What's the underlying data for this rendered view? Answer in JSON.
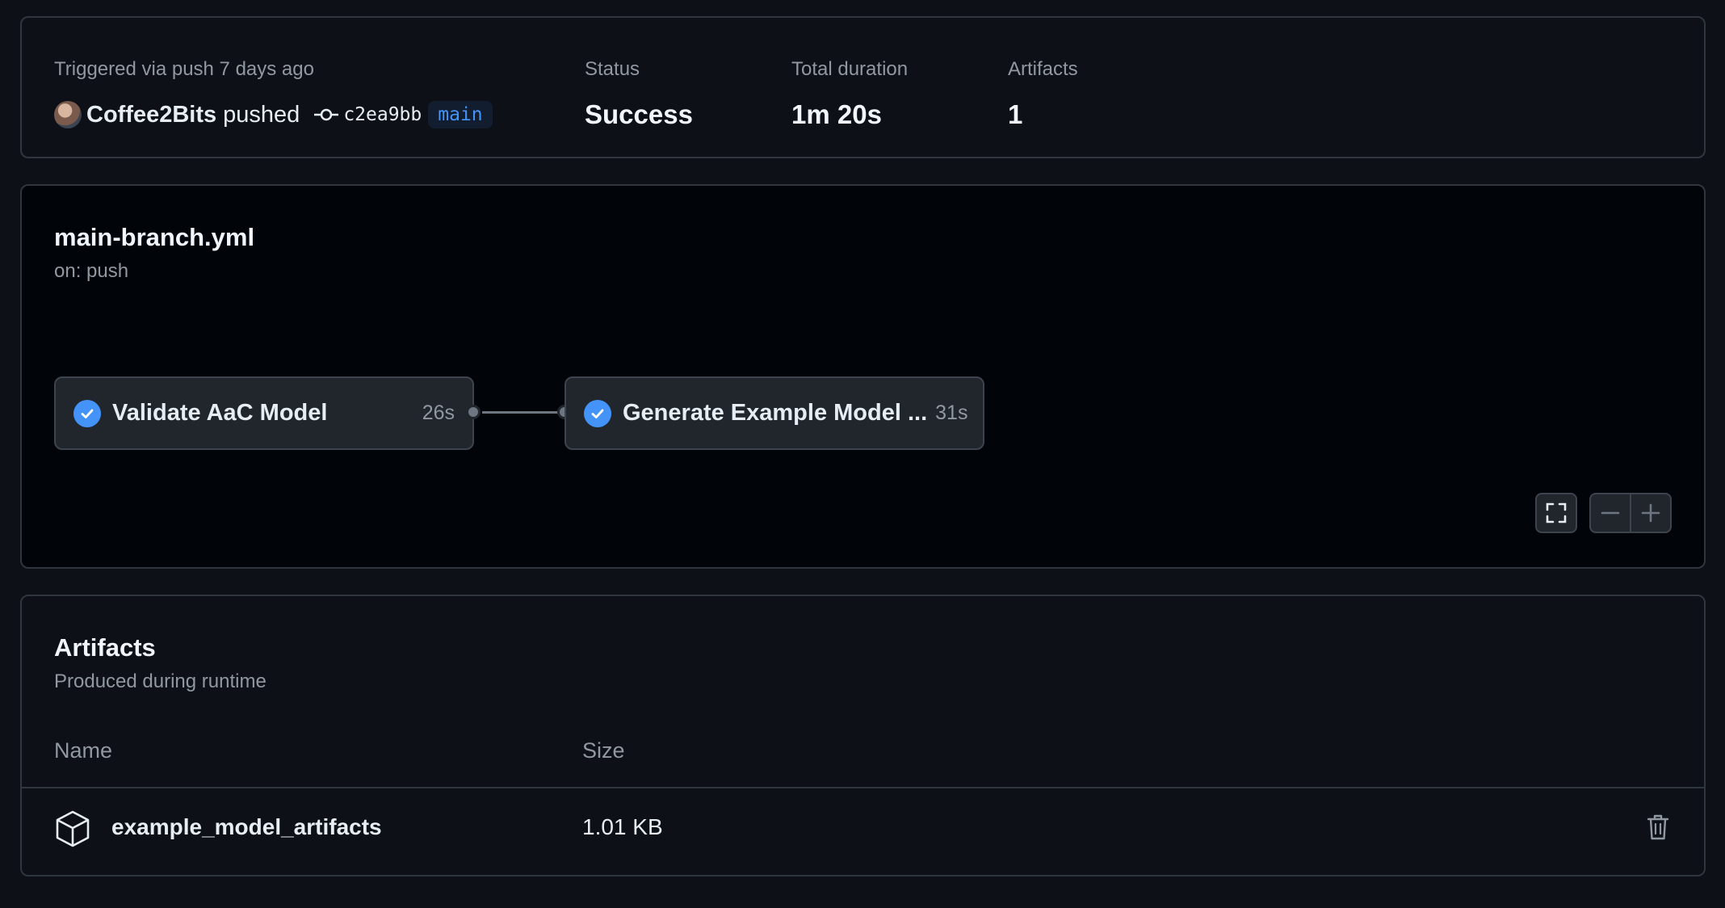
{
  "summary": {
    "trigger_label": "Triggered via push 7 days ago",
    "actor": "Coffee2Bits",
    "action": "pushed",
    "commit_sha": "c2ea9bb",
    "branch": "main",
    "status_label": "Status",
    "status_value": "Success",
    "duration_label": "Total duration",
    "duration_value": "1m 20s",
    "artifacts_label": "Artifacts",
    "artifacts_value": "1"
  },
  "workflow": {
    "file": "main-branch.yml",
    "trigger": "on: push",
    "jobs": [
      {
        "name": "Validate AaC Model",
        "duration": "26s",
        "status": "success"
      },
      {
        "name": "Generate Example Model ...",
        "duration": "31s",
        "status": "success"
      }
    ],
    "controls": {
      "fullscreen_icon": "fullscreen-icon",
      "zoom_out_icon": "minus-icon",
      "zoom_in_icon": "plus-icon"
    }
  },
  "artifacts": {
    "title": "Artifacts",
    "subtitle": "Produced during runtime",
    "columns": [
      "Name",
      "Size"
    ],
    "rows": [
      {
        "name": "example_model_artifacts",
        "size": "1.01 KB",
        "icon": "package-icon",
        "action_icon": "trash-icon"
      }
    ]
  },
  "colors": {
    "background": "#0d1117",
    "canvas": "#010409",
    "border": "#30363d",
    "accent": "#4493f8",
    "muted_text": "#9198a1"
  }
}
